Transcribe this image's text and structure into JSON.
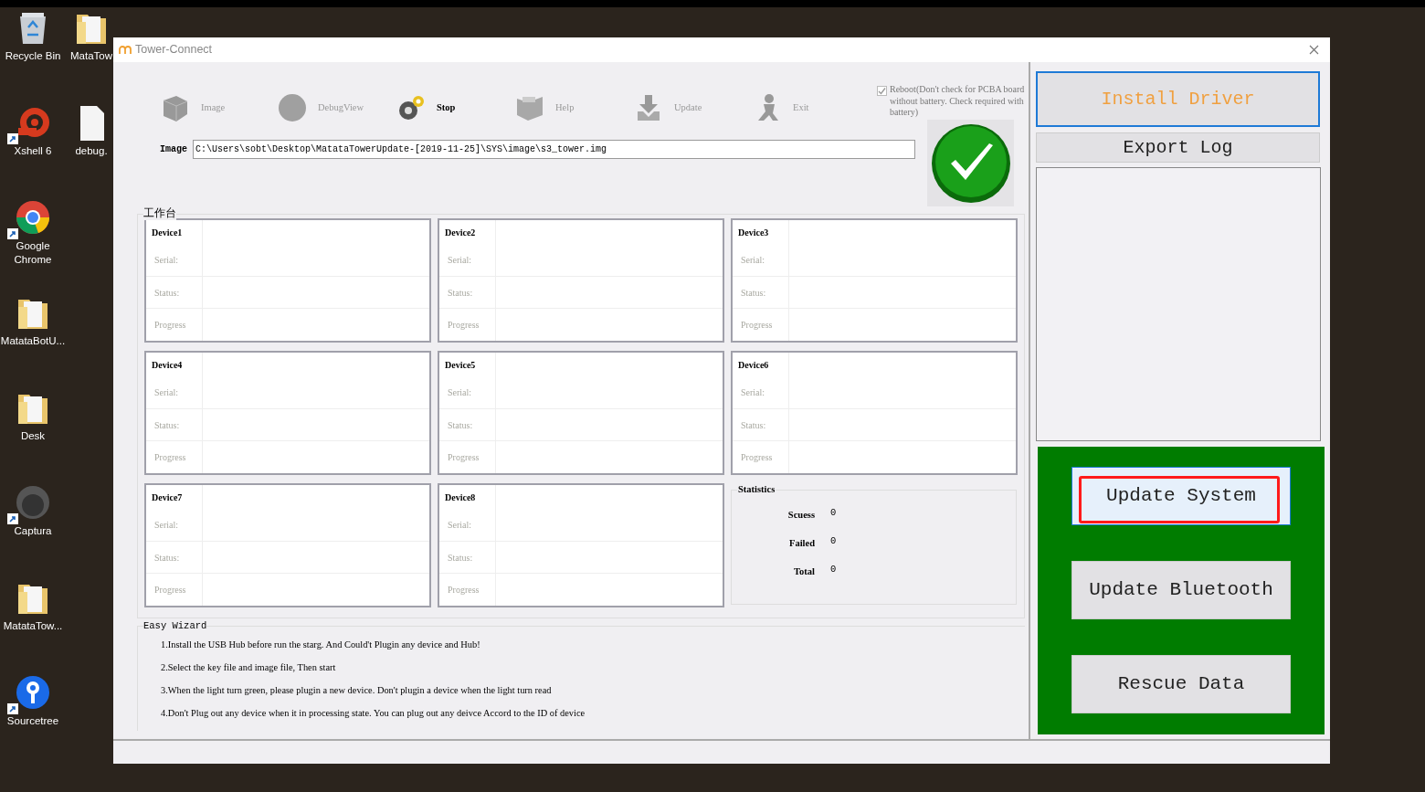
{
  "desktop_icons": [
    {
      "label": "Recycle Bin",
      "kind": "bin",
      "shortcut": false
    },
    {
      "label": "Xshell 6",
      "kind": "shell",
      "shortcut": true
    },
    {
      "label": "Google Chrome",
      "kind": "browser",
      "shortcut": true
    },
    {
      "label": "MatataBotU...",
      "kind": "folder",
      "shortcut": false
    },
    {
      "label": "Desk",
      "kind": "folder",
      "shortcut": false
    },
    {
      "label": "Captura",
      "kind": "disc",
      "shortcut": true
    },
    {
      "label": "MatataTow...",
      "kind": "folder",
      "shortcut": false
    },
    {
      "label": "Sourcetree",
      "kind": "pin",
      "shortcut": true
    }
  ],
  "partly_covered_desktop_icons": [
    {
      "label": "MataTow",
      "kind": "folder",
      "shortcut": false
    },
    {
      "label": "debug.",
      "kind": "document",
      "shortcut": false
    }
  ],
  "window": {
    "title": "Tower-Connect"
  },
  "toolbar": [
    {
      "label": "Image",
      "kind": "box",
      "disabled": true
    },
    {
      "label": "DebugView",
      "kind": "circle",
      "disabled": true
    },
    {
      "label": "Stop",
      "kind": "gears",
      "disabled": false
    },
    {
      "label": "Help",
      "kind": "book",
      "disabled": true
    },
    {
      "label": "Update",
      "kind": "download",
      "disabled": true
    },
    {
      "label": "Exit",
      "kind": "runner",
      "disabled": true
    }
  ],
  "reboot_option": {
    "label": "Reboot(Don't check for PCBA board without battery. Check required with battery)",
    "checked": true
  },
  "image_path": {
    "label": "Image",
    "value": "C:\\Users\\sobt\\Desktop\\MatataTowerUpdate-[2019-11-25]\\SYS\\image\\s3_tower.img"
  },
  "light": {
    "ready": true
  },
  "workbench": {
    "title": "工作台",
    "devices": [
      {
        "name": "Device1",
        "fields": [
          "Serial:",
          "Status:",
          "Progress"
        ]
      },
      {
        "name": "Device2",
        "fields": [
          "Serial:",
          "Status:",
          "Progress"
        ]
      },
      {
        "name": "Device3",
        "fields": [
          "Serial:",
          "Status:",
          "Progress"
        ]
      },
      {
        "name": "Device4",
        "fields": [
          "Serial:",
          "Status:",
          "Progress"
        ]
      },
      {
        "name": "Device5",
        "fields": [
          "Serial:",
          "Status:",
          "Progress"
        ]
      },
      {
        "name": "Device6",
        "fields": [
          "Serial:",
          "Status:",
          "Progress"
        ]
      },
      {
        "name": "Device7",
        "fields": [
          "Serial:",
          "Status:",
          "Progress"
        ]
      },
      {
        "name": "Device8",
        "fields": [
          "Serial:",
          "Status:",
          "Progress"
        ]
      }
    ],
    "statistics": {
      "title": "Statistics",
      "rows": [
        {
          "label": "Scuess",
          "value": "0"
        },
        {
          "label": "Failed",
          "value": "0"
        },
        {
          "label": "Total",
          "value": "0"
        }
      ]
    }
  },
  "wizard": {
    "title": "Easy Wizard",
    "steps": [
      "1.Install the USB Hub before run the starg. And Could't Plugin any device and Hub!",
      "2.Select the key file and image file, Then start",
      "3.When the light turn green, please plugin a new device. Don't plugin a device when the light turn read",
      "4.Don't Plug out any device when it in processing state. You can plug out any deivce Accord to the ID of device"
    ]
  },
  "side_buttons": [
    {
      "label": "Install Driver",
      "focused": true
    },
    {
      "label": "Export Log",
      "focused": false
    }
  ],
  "actions": [
    {
      "label": "Update System",
      "hovered": true,
      "marked": true
    },
    {
      "label": "Update Bluetooth",
      "hovered": false,
      "marked": false
    },
    {
      "label": "Rescue Data",
      "hovered": false,
      "marked": false
    }
  ]
}
